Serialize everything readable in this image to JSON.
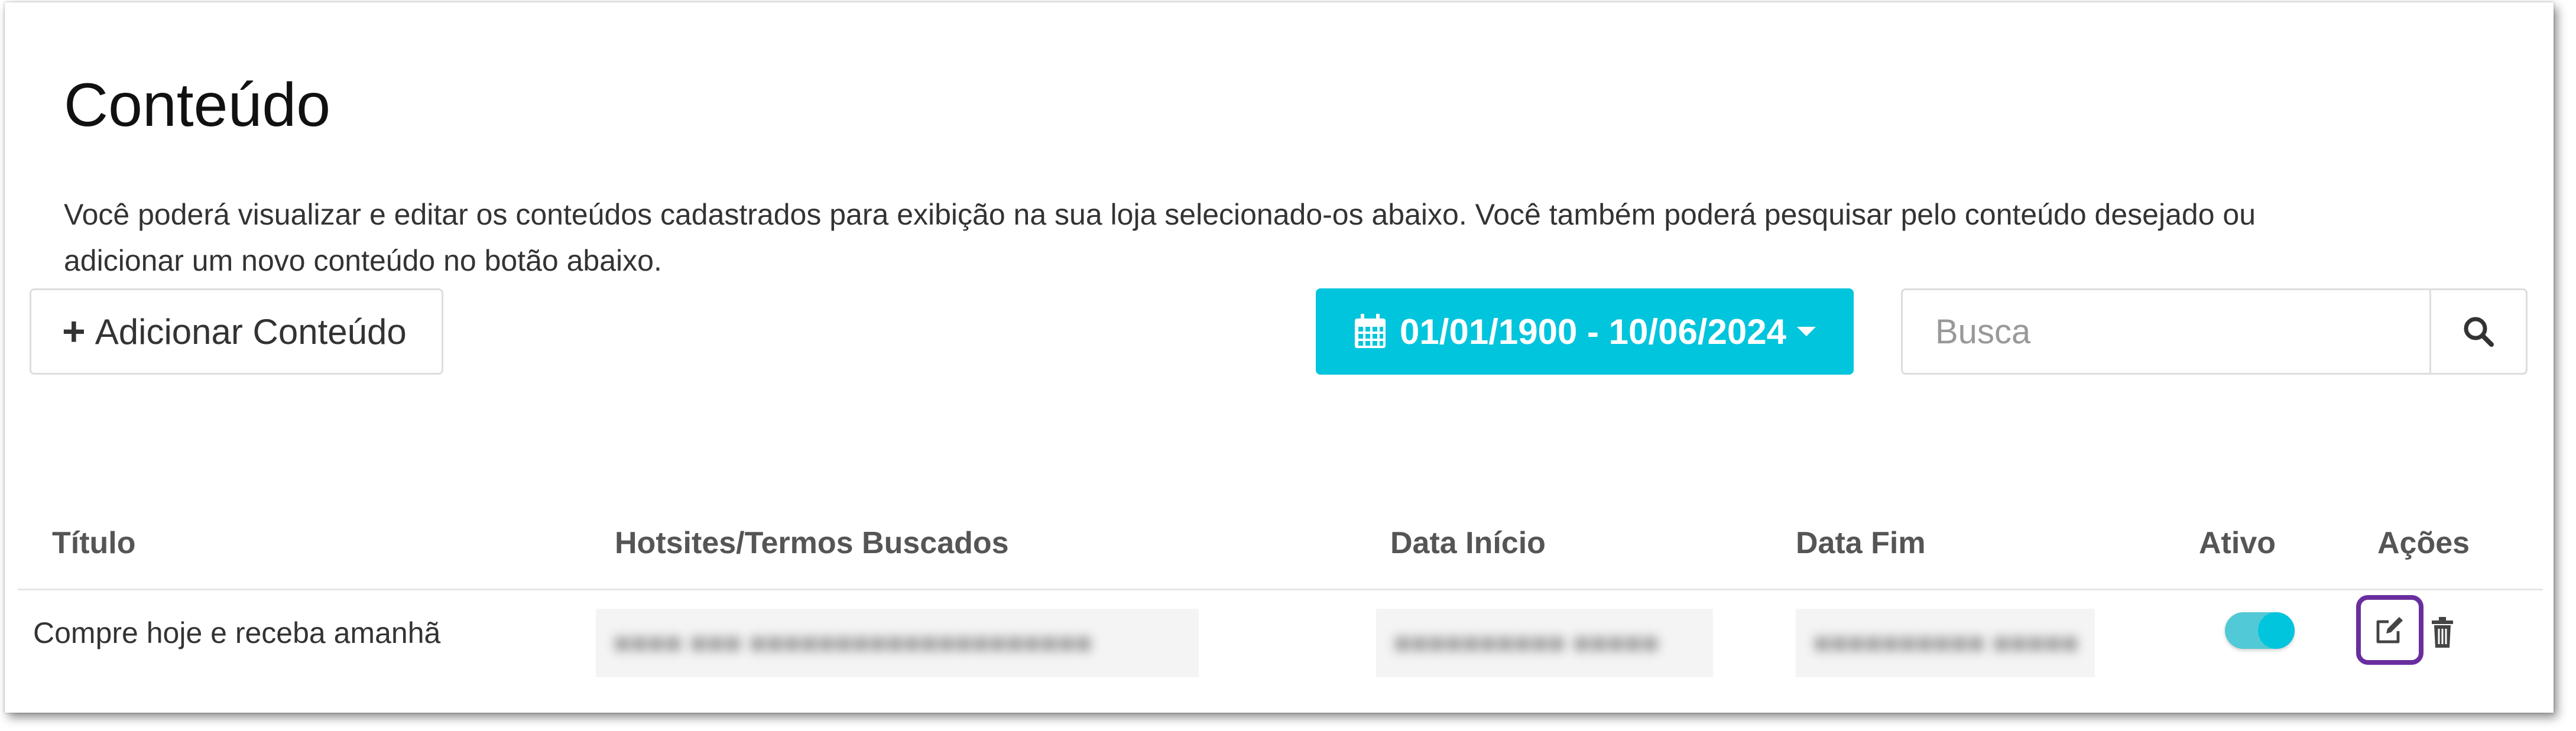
{
  "page": {
    "title": "Conteúdo",
    "description": "Você poderá visualizar e editar os conteúdos cadastrados para exibição na sua loja selecionado-os abaixo. Você também poderá pesquisar pelo conteúdo desejado ou adicionar um novo conteúdo no botão abaixo."
  },
  "toolbar": {
    "add_label": "Adicionar Conteúdo",
    "add_icon": "plus-icon",
    "date_range": "01/01/1900 - 10/06/2024",
    "date_icon": "calendar-icon",
    "search_placeholder": "Busca",
    "search_value": "",
    "search_icon": "magnifier-icon"
  },
  "table": {
    "columns": [
      "Título",
      "Hotsites/Termos Buscados",
      "Data Início",
      "Data Fim",
      "Ativo",
      "Ações"
    ],
    "rows": [
      {
        "titulo": "Compre hoje e receba amanhã",
        "ativo": true,
        "actions": [
          "edit-icon",
          "trash-icon"
        ]
      }
    ]
  },
  "colors": {
    "accent": "#00c5dc",
    "toggle_track": "#52c9d6",
    "highlight_border": "#6a2e9e"
  }
}
